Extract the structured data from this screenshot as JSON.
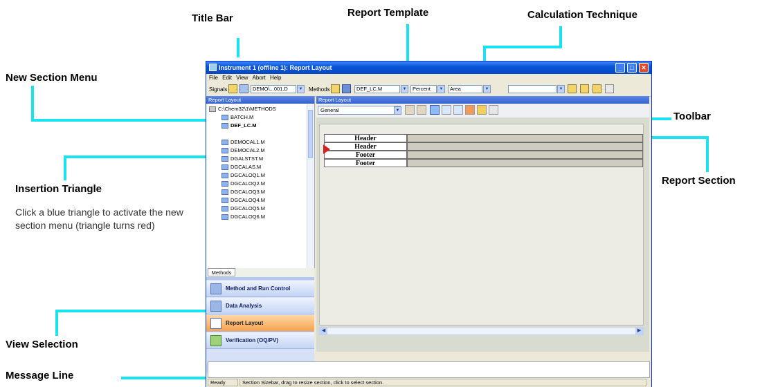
{
  "annotations": {
    "title_bar": "Title Bar",
    "report_template": "Report Template",
    "calculation_technique": "Calculation Technique",
    "new_section_menu": "New Section Menu",
    "toolbar": "Toolbar",
    "insertion_triangle": "Insertion Triangle",
    "insertion_triangle_desc": "Click a blue triangle to activate the new section menu (triangle turns red)",
    "report_section": "Report Section",
    "view_selection": "View Selection",
    "message_line": "Message Line"
  },
  "window": {
    "title": "Instrument 1 (offline 1): Report Layout",
    "menu": [
      "File",
      "Edit",
      "View",
      "Abort",
      "Help"
    ],
    "toolbar": {
      "signals_label": "Signals",
      "signal_file": "DEMO\\...001.D",
      "methods_label": "Methods",
      "method_file": "DEF_LC.M",
      "report_style": "Percent",
      "calc_technique": "Area"
    }
  },
  "left_pane": {
    "header": "Report Layout",
    "root": "C:\\Chem32\\1\\METHODS",
    "items": [
      "BATCH.M",
      "DEF_LC.M",
      "DEMOCAL1.M",
      "DEMOCAL2.M",
      "DGALSTST.M",
      "DGCALAS.M",
      "DGCALOQ1.M",
      "DGCALOQ2.M",
      "DGCALOQ3.M",
      "DGCALOQ4.M",
      "DGCALOQ5.M",
      "DGCALOQ6.M"
    ],
    "tab": "Methods"
  },
  "navigation": [
    {
      "label": "Method and Run Control",
      "active": false
    },
    {
      "label": "Data Analysis",
      "active": false
    },
    {
      "label": "Report Layout",
      "active": true
    },
    {
      "label": "Verification (OQ/PV)",
      "active": false
    }
  ],
  "right_pane": {
    "header": "Report Layout",
    "section_combo": "General",
    "rows": [
      "Header",
      "Header",
      "Footer",
      "Footer"
    ]
  },
  "status": {
    "state": "Ready",
    "message": "Section Sizebar, drag to resize section, click to select section."
  },
  "colors": {
    "callout": "#19e3ec",
    "active_triangle": "#d42020",
    "active_nav": "#f7a24f"
  }
}
